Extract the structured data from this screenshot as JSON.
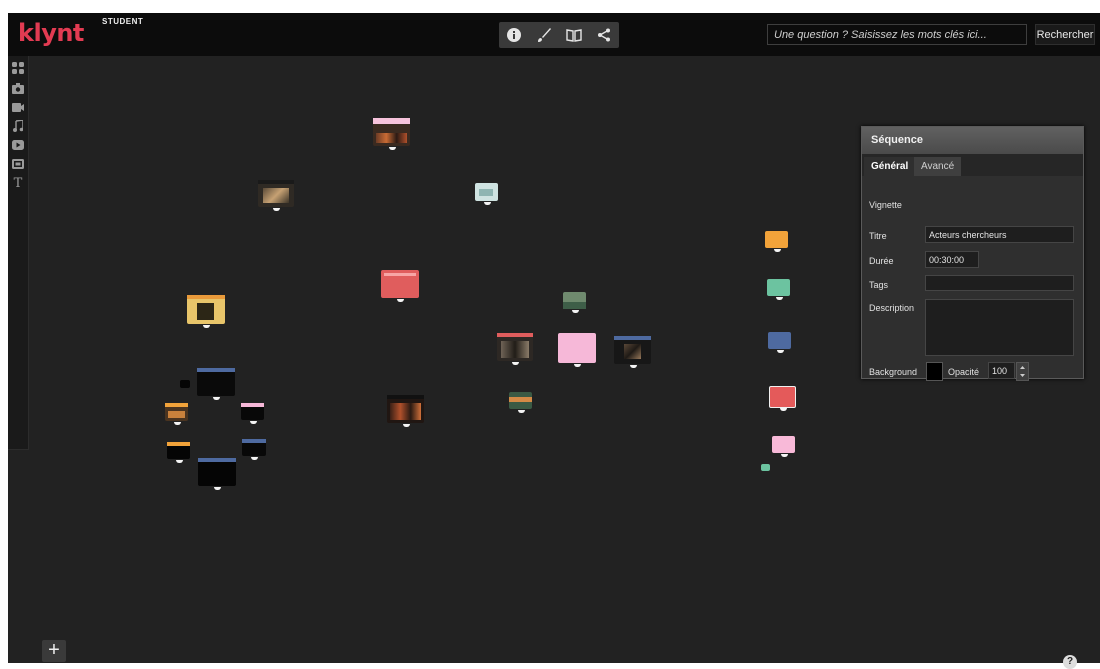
{
  "app": {
    "brand": "klynt",
    "edition": "STUDENT"
  },
  "toolbar": {
    "icons": [
      "info-icon",
      "brush-icon",
      "book-icon",
      "share-icon"
    ]
  },
  "search": {
    "placeholder": "Une question ? Saisissez les mots clés ici...",
    "button_label": "Rechercher"
  },
  "left_tools": [
    "apps-grid-icon",
    "camera-icon",
    "video-camera-icon",
    "music-note-icon",
    "youtube-play-icon",
    "photo-gallery-icon",
    "text-t-icon"
  ],
  "left_tools_text_label": "T",
  "colors": {
    "brand": "#e23b52",
    "canvas": "#222222",
    "node_orange": "#f2a33a",
    "node_green": "#6cc3a0",
    "node_blue": "#4e6aa0",
    "node_red": "#e45a5a",
    "node_pink": "#f8b9d8"
  },
  "panel": {
    "title": "Séquence",
    "tabs": [
      "Général",
      "Avancé"
    ],
    "labels": {
      "vignette": "Vignette",
      "titre": "Titre",
      "duree": "Durée",
      "tags": "Tags",
      "description": "Description",
      "background": "Background",
      "opacite": "Opacité"
    },
    "values": {
      "titre": "Acteurs chercheurs",
      "duree": "00:30:00",
      "tags": "",
      "description": "",
      "opacite": "100",
      "background_color": "#000000"
    }
  },
  "footer": {
    "add_label": "+",
    "help_label": "?"
  }
}
